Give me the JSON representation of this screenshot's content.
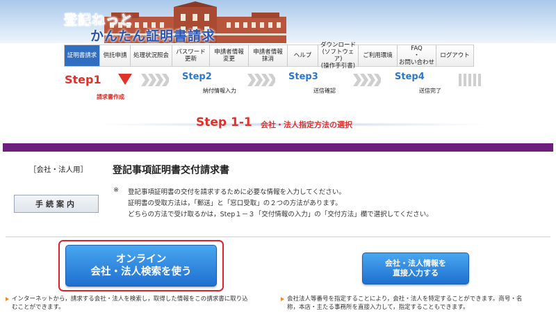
{
  "header": {
    "brand_line1": "登記ねっと",
    "brand_line2": "かんたん証明書請求"
  },
  "nav": {
    "items": [
      {
        "label": "証明書請求",
        "active": true
      },
      {
        "label": "供託申請"
      },
      {
        "label": "処理状況照会"
      },
      {
        "label": "パスワード\n更新"
      },
      {
        "label": "申請者情報\n変更"
      },
      {
        "label": "申請者情報\n抹消"
      },
      {
        "label": "ヘルプ"
      },
      {
        "label": "ダウンロード\n(ソフトウェア)\n(操作手引書)"
      },
      {
        "label": "ご利用環境"
      },
      {
        "label": "FAQ\n・\nお問い合わせ"
      },
      {
        "label": "ログアウト"
      }
    ]
  },
  "steps": [
    {
      "label": "Step1",
      "sub": "請求書作成"
    },
    {
      "label": "Step2",
      "sub": "納付情報入力"
    },
    {
      "label": "Step3",
      "sub": "送信確認"
    },
    {
      "label": "Step4",
      "sub": "送信完了"
    }
  ],
  "subtitle": {
    "step": "Step 1-1",
    "text": "会社・法人指定方法の選択"
  },
  "form": {
    "entity_tag": "［会社・法人用］",
    "title": "登記事項証明書交付請求書",
    "guide_button": "手続案内",
    "note_mark": "※",
    "notes": [
      "登記事項証明書の交付を請求するために必要な情報を入力してください。",
      "証明書の受取方法は，「郵送」と「窓口受取」の２つの方法があります。",
      "どちらの方法で受け取るかは，Step１－３「交付情報の入力」の「交付方法」欄で選択してください。"
    ]
  },
  "options": {
    "online_line1": "オンライン",
    "online_line2": "会社・法人検索を使う",
    "direct_line1": "会社・法人情報を",
    "direct_line2": "直接入力する",
    "online_desc_line1": "インターネットから，請求する会社・法人を検索し，取得した情報をこの請求書に取り込",
    "online_desc_line2": "むことができます。",
    "direct_desc_line1": "会社法人等番号を指定することにより，会社・法人を特定することができます。商号・名",
    "direct_desc_line2": "称，本店・主たる事務所を直接入力して，指定することもできます。"
  },
  "colors": {
    "accent_red": "#e0312b",
    "step_blue": "#2b78c8",
    "purple_bar": "#6d1f7d",
    "button_blue": "#2f86e0"
  }
}
